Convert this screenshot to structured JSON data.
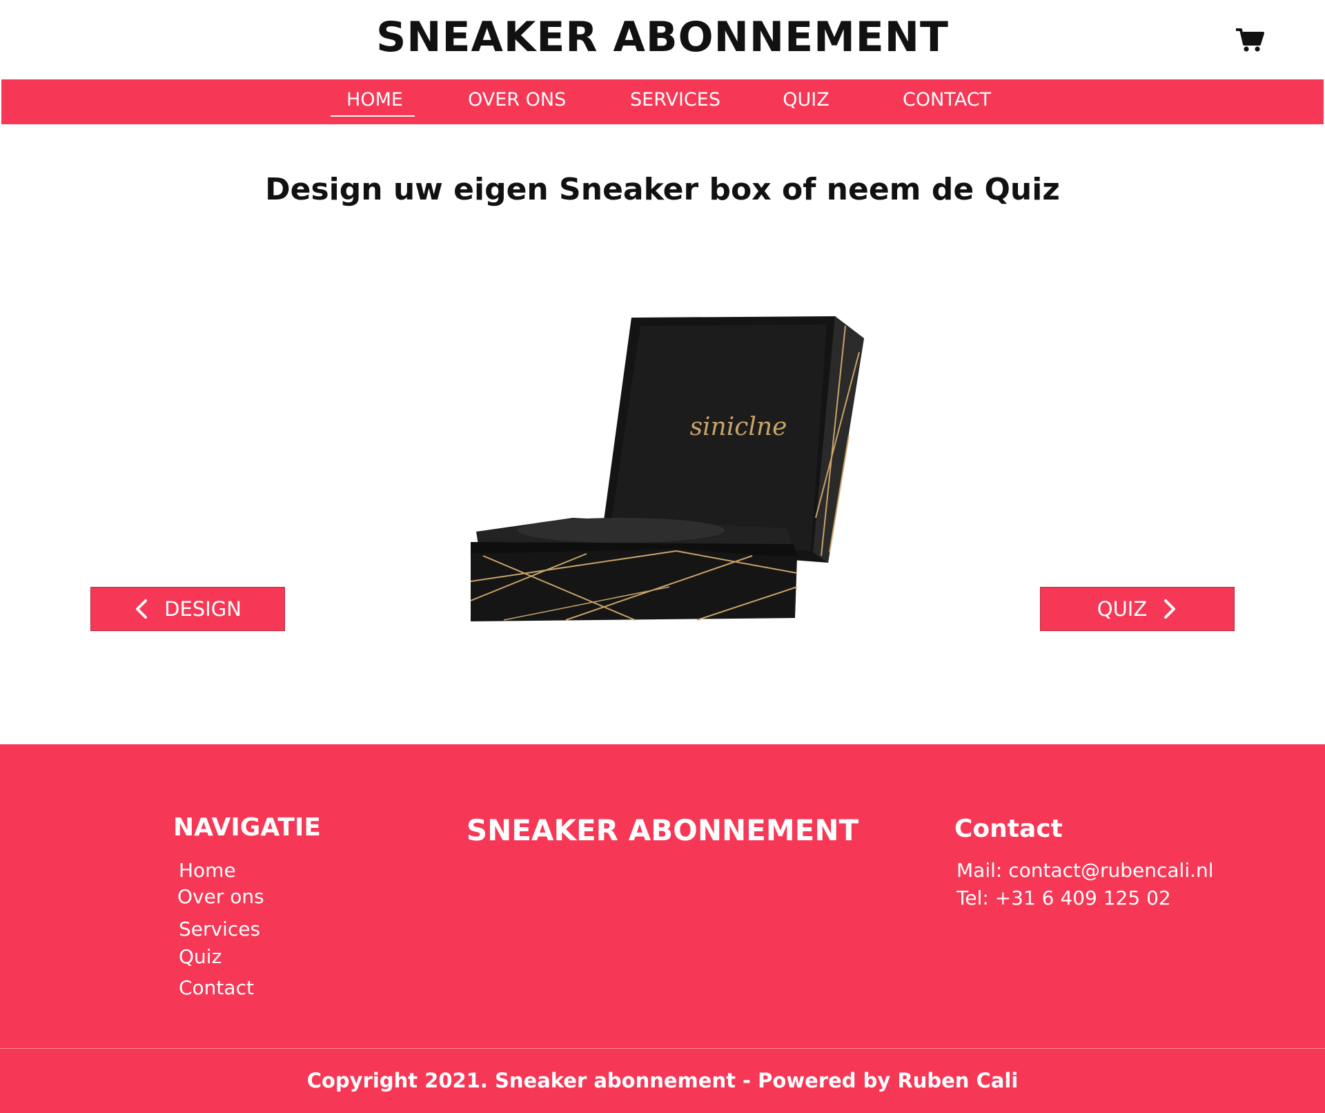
{
  "header": {
    "title": "SNEAKER ABONNEMENT",
    "cart_icon": "shopping-cart-icon"
  },
  "nav": {
    "items": [
      {
        "label": "HOME",
        "active": true
      },
      {
        "label": "OVER ONS",
        "active": false
      },
      {
        "label": "SERVICES",
        "active": false
      },
      {
        "label": "QUIZ",
        "active": false
      },
      {
        "label": "CONTACT",
        "active": false
      }
    ],
    "background": "#f63755"
  },
  "main": {
    "headline": "Design uw eigen Sneaker box of neem de Quiz",
    "product_brand": "siniclne",
    "prev_button": {
      "label": "DESIGN",
      "icon": "chevron-left-icon"
    },
    "next_button": {
      "label": "QUIZ",
      "icon": "chevron-right-icon"
    }
  },
  "footer": {
    "navigation": {
      "heading": "NAVIGATIE",
      "links": [
        "Home",
        "Over ons",
        "Services",
        "Quiz",
        "Contact"
      ]
    },
    "brand": "SNEAKER ABONNEMENT",
    "contact": {
      "heading": "Contact",
      "mail": "Mail: contact@rubencali.nl",
      "tel": "Tel: +31 6 409 125 02"
    },
    "copyright": "Copyright 2021. Sneaker abonnement - Powered by Ruben Cali"
  },
  "colors": {
    "accent": "#f63755",
    "text_dark": "#111111",
    "box_gold": "#c9a46a"
  }
}
